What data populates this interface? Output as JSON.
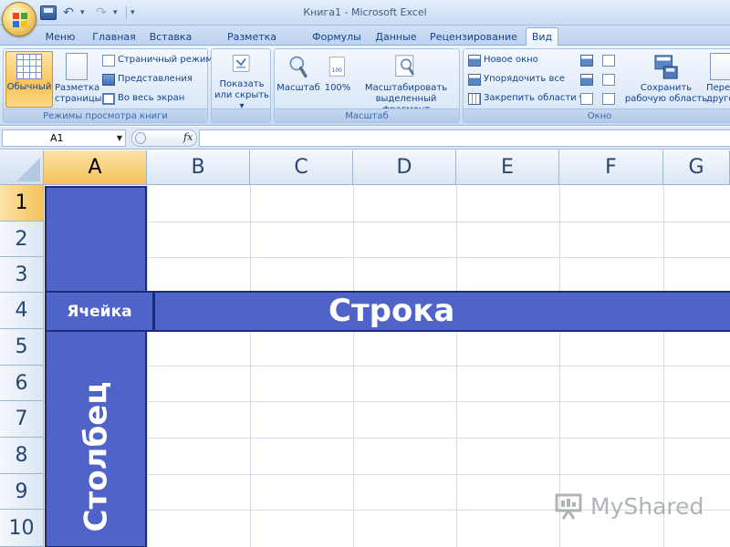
{
  "window": {
    "title": "Книга1 - Microsoft Excel"
  },
  "tabs": [
    "Меню",
    "Главная",
    "Вставка",
    "Разметка страницы",
    "Формулы",
    "Данные",
    "Рецензирование",
    "Вид"
  ],
  "active_tab": "Вид",
  "ribbon": {
    "groups": {
      "views": {
        "label": "Режимы просмотра книги",
        "normal": "Обычный",
        "page_layout_1": "Разметка",
        "page_layout_2": "страницы",
        "page_break": "Страничный режим",
        "custom_views": "Представления",
        "full_screen": "Во весь экран"
      },
      "show": {
        "show_hide_1": "Показать",
        "show_hide_2": "или скрыть"
      },
      "zoom": {
        "label": "Масштаб",
        "zoom": "Масштаб",
        "hundred": "100%",
        "icon_text": "100",
        "zoom_selection_1": "Масштабировать",
        "zoom_selection_2": "выделенный фрагмент"
      },
      "window": {
        "label": "Окно",
        "new_window": "Новое окно",
        "arrange_all": "Упорядочить все",
        "freeze_panes": "Закрепить области",
        "save_workspace_1": "Сохранить",
        "save_workspace_2": "рабочую область",
        "switch_1": "Перей",
        "switch_2": "другое"
      }
    }
  },
  "formula_bar": {
    "name_box": "A1",
    "fx": "fx",
    "value": ""
  },
  "sheet": {
    "columns": [
      "A",
      "B",
      "C",
      "D",
      "E",
      "F",
      "G"
    ],
    "rows": [
      "1",
      "2",
      "3",
      "4",
      "5",
      "6",
      "7",
      "8",
      "9",
      "10"
    ],
    "selected_column": "A",
    "selected_row": "1"
  },
  "annotations": {
    "cell": "Ячейка",
    "row": "Строка",
    "column": "Столбец"
  },
  "watermark": {
    "text": "MyShared"
  },
  "colors": {
    "highlight": "#4f63c8",
    "highlight_border": "#1c2b78",
    "header_selected": "#f7c25a"
  }
}
